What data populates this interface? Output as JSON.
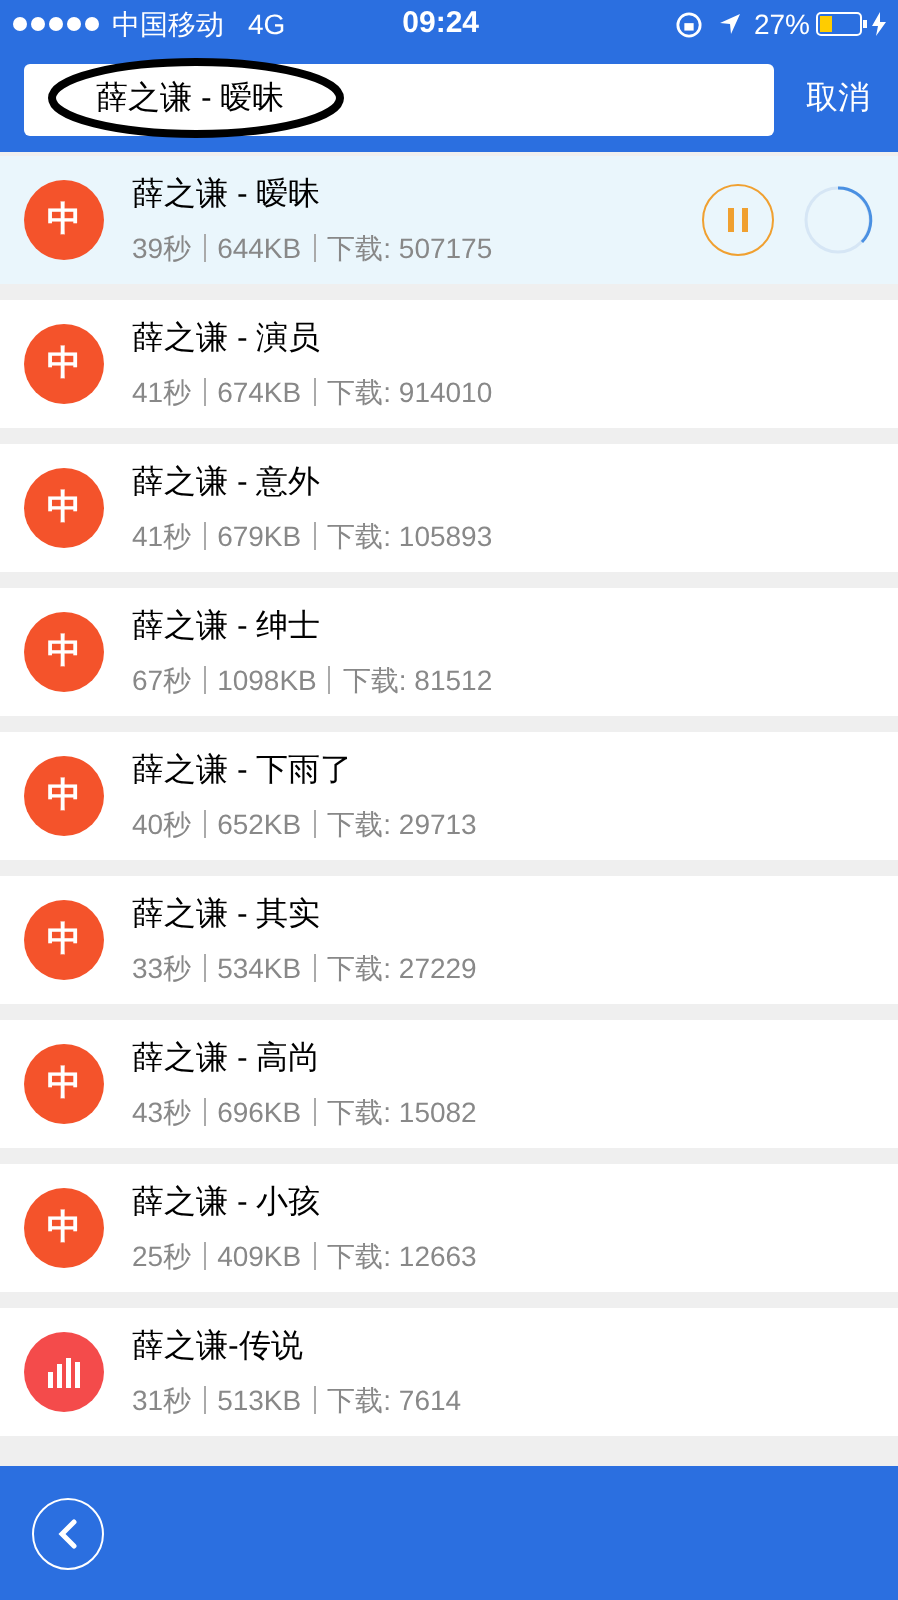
{
  "status_bar": {
    "carrier": "中国移动",
    "network": "4G",
    "time": "09:24",
    "battery": "27%"
  },
  "search": {
    "value": "薛之谦 - 暧昧",
    "cancel": "取消"
  },
  "songs": [
    {
      "kind": "text_icon",
      "icon_char": "中",
      "title": "薛之谦 - 暧昧",
      "duration": "39秒",
      "size": "644KB",
      "downloads": "下载: 507175",
      "selected": true
    },
    {
      "kind": "text_icon",
      "icon_char": "中",
      "title": "薛之谦 - 演员",
      "duration": "41秒",
      "size": "674KB",
      "downloads": "下载: 914010",
      "selected": false
    },
    {
      "kind": "text_icon",
      "icon_char": "中",
      "title": "薛之谦 - 意外",
      "duration": "41秒",
      "size": "679KB",
      "downloads": "下载: 105893",
      "selected": false
    },
    {
      "kind": "text_icon",
      "icon_char": "中",
      "title": "薛之谦 - 绅士",
      "duration": "67秒",
      "size": "1098KB",
      "downloads": "下载: 81512",
      "selected": false
    },
    {
      "kind": "text_icon",
      "icon_char": "中",
      "title": "薛之谦 - 下雨了",
      "duration": "40秒",
      "size": "652KB",
      "downloads": "下载: 29713",
      "selected": false
    },
    {
      "kind": "text_icon",
      "icon_char": "中",
      "title": "薛之谦 - 其实",
      "duration": "33秒",
      "size": "534KB",
      "downloads": "下载: 27229",
      "selected": false
    },
    {
      "kind": "text_icon",
      "icon_char": "中",
      "title": "薛之谦 - 高尚",
      "duration": "43秒",
      "size": "696KB",
      "downloads": "下载: 15082",
      "selected": false
    },
    {
      "kind": "text_icon",
      "icon_char": "中",
      "title": "薛之谦 - 小孩",
      "duration": "25秒",
      "size": "409KB",
      "downloads": "下载: 12663",
      "selected": false
    },
    {
      "kind": "bars_icon",
      "title": "薛之谦-传说",
      "duration": "31秒",
      "size": "513KB",
      "downloads": "下载: 7614",
      "selected": false
    }
  ]
}
